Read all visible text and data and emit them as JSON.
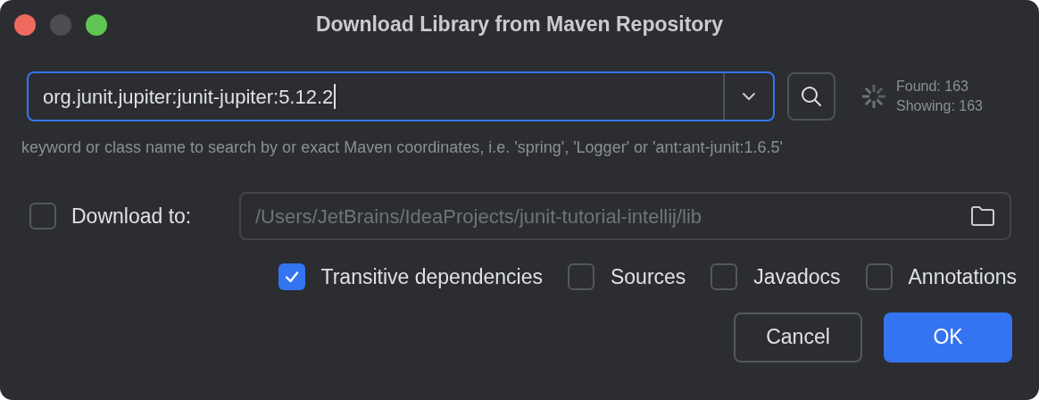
{
  "window": {
    "title": "Download Library from Maven Repository",
    "controls": [
      {
        "color": "#ee6a5f"
      },
      {
        "color": "#4c4d50"
      },
      {
        "color": "#5fc454"
      }
    ]
  },
  "search": {
    "value": "org.junit.jupiter:junit-jupiter:5.12.2",
    "focused": true
  },
  "results": {
    "found": "Found: 163",
    "showing": "Showing: 163"
  },
  "hint": "keyword or class name to search by or exact Maven coordinates, i.e. 'spring', 'Logger' or 'ant:ant-junit:1.6.5'",
  "download_to": {
    "label": "Download to:",
    "checked": false,
    "path": "/Users/JetBrains/IdeaProjects/junit-tutorial-intellij/lib",
    "disabled": true
  },
  "options": [
    {
      "label": "Transitive dependencies",
      "checked": true
    },
    {
      "label": "Sources",
      "checked": false
    },
    {
      "label": "Javadocs",
      "checked": false
    },
    {
      "label": "Annotations",
      "checked": false
    }
  ],
  "buttons": [
    {
      "label": "Cancel",
      "kind": "secondary"
    },
    {
      "label": "OK",
      "kind": "primary"
    }
  ]
}
